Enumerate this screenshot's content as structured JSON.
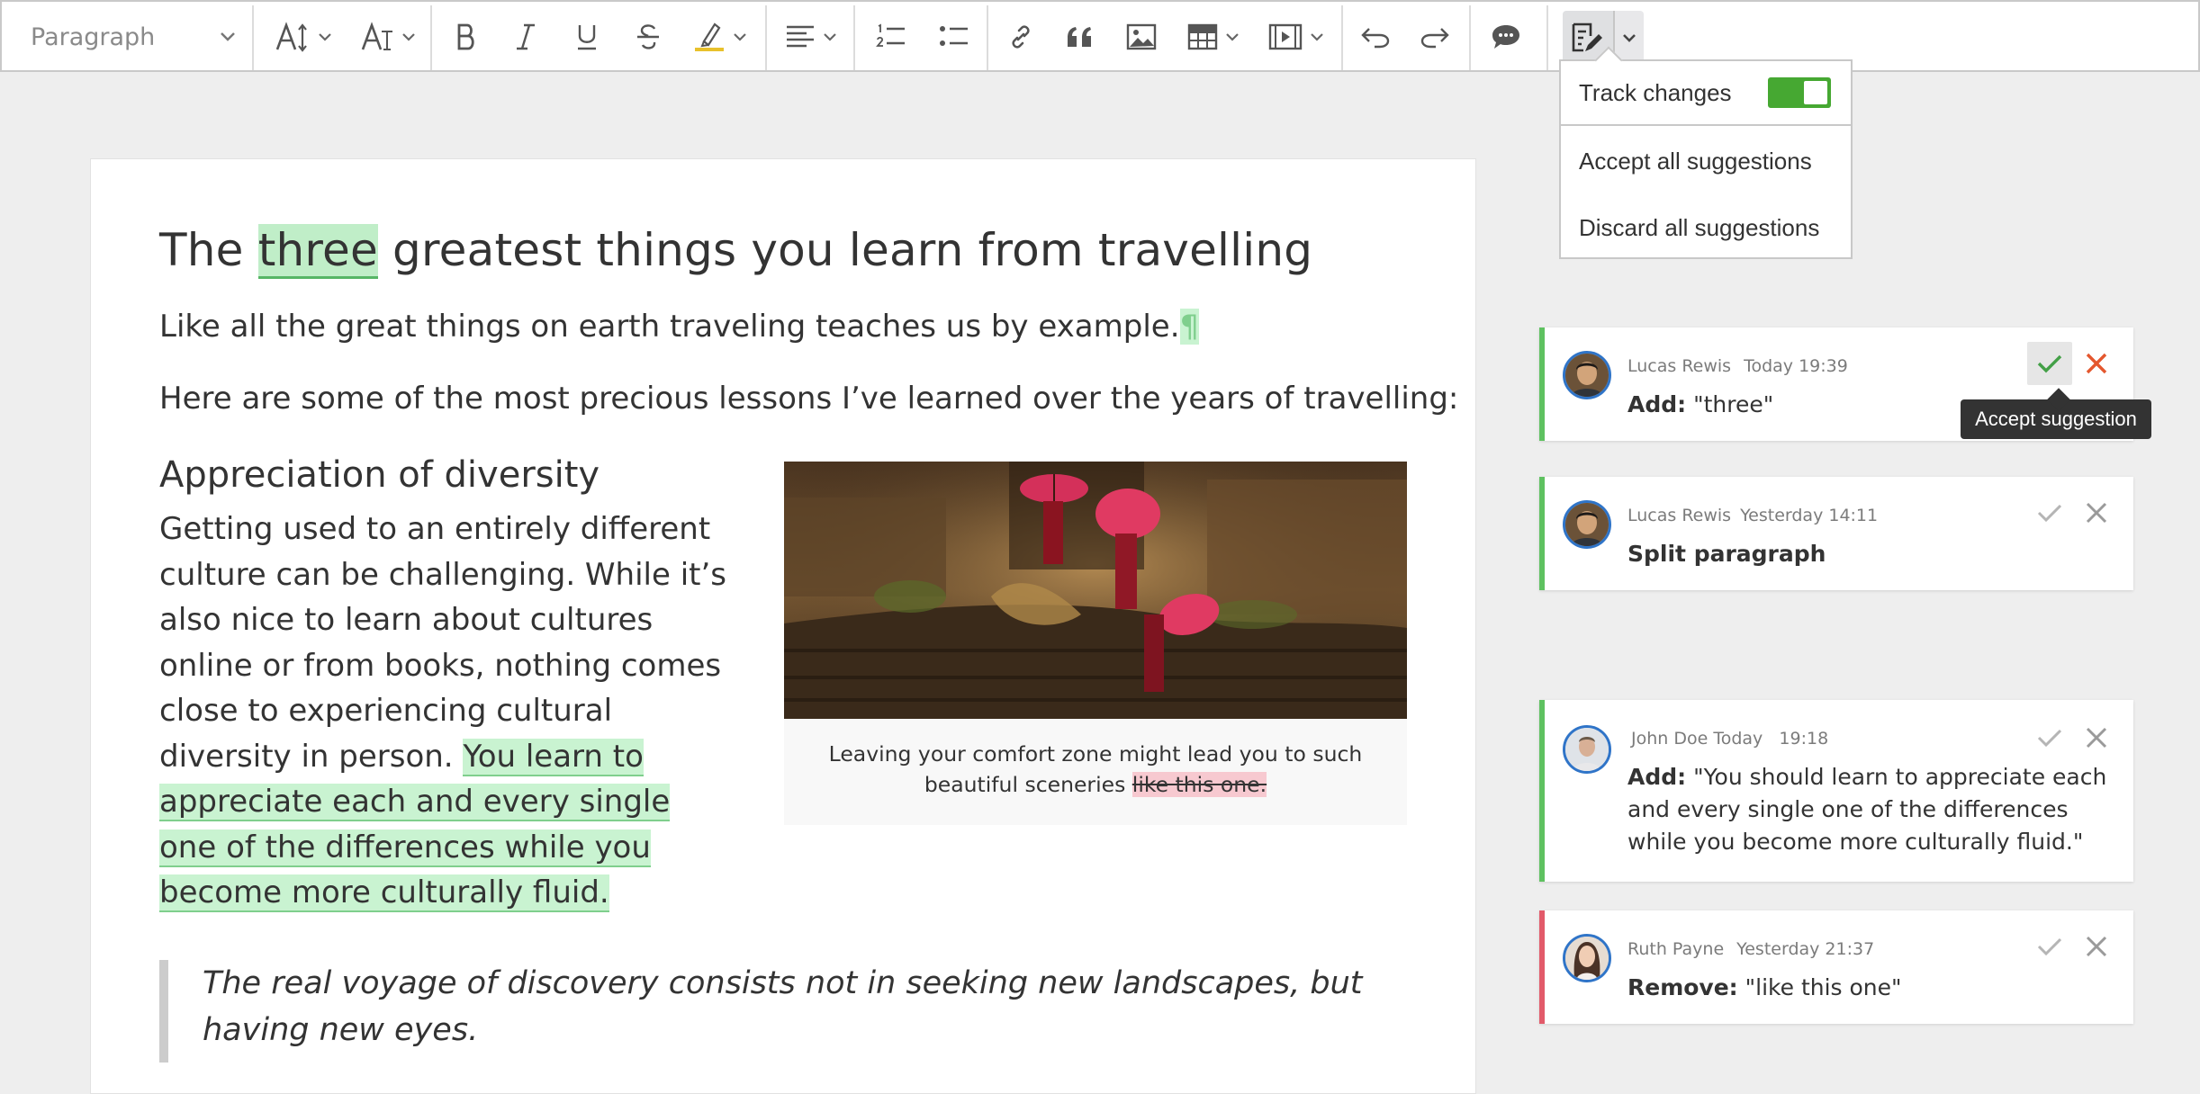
{
  "toolbar": {
    "paragraph_select": "Paragraph",
    "icons": [
      "font-size-icon",
      "font-family-icon",
      "bold-icon",
      "italic-icon",
      "underline-icon",
      "strikethrough-icon",
      "highlight-icon",
      "alignment-icon",
      "numbered-list-icon",
      "bulleted-list-icon",
      "link-icon",
      "blockquote-icon",
      "image-icon",
      "table-icon",
      "media-icon",
      "undo-icon",
      "redo-icon",
      "comment-icon",
      "track-changes-icon"
    ]
  },
  "track_menu": {
    "track_changes_label": "Track changes",
    "track_changes_on": true,
    "accept_all": "Accept all suggestions",
    "discard_all": "Discard all suggestions"
  },
  "document": {
    "title_before": "The ",
    "title_suggestion": "three",
    "title_after": " greatest things you learn from travelling",
    "para1_text": "Like all the great things on earth traveling teaches us by example.",
    "para1_mark": "¶",
    "para2": "Here are some of the most precious lessons I’ve learned over the years of travelling:",
    "heading2": "Appreciation of diversity",
    "para3_text": "Getting used to an entirely different culture can be challenging. While it’s also nice to learn about cultures online or from books, nothing comes close to experiencing cultural diversity in person. ",
    "para3_insert": "You learn to appreciate each and every single one of the differences while you become more culturally fluid.",
    "caption_text": "Leaving your comfort zone might lead you to such beautiful sceneries ",
    "caption_removed": "like this one.",
    "quote": "The real voyage of discovery consists not in seeking new landscapes, but having new eyes."
  },
  "suggestions": [
    {
      "author": "Lucas Rewis",
      "time": "Today 19:39",
      "label": "Add:",
      "text": "\"three\"",
      "status_color": "#5ec160"
    },
    {
      "author": "Lucas Rewis",
      "time": "Yesterday 14:11",
      "label": "",
      "text": "Split paragraph",
      "status_color": "#5ec160"
    },
    {
      "author": "John Doe",
      "time": "Today   19:18",
      "label": "Add:",
      "text": "\"You should learn to appreciate each and every single one of the differences while you become more culturally fluid.\"",
      "status_color": "#5ec160"
    },
    {
      "author": "Ruth Payne",
      "time": "Yesterday 21:37",
      "label": "Remove:",
      "text": "\"like this one\"",
      "status_color": "#e25a6a"
    }
  ],
  "tooltip": "Accept suggestion",
  "colors": {
    "insert_highlight": "#c9f3d1",
    "remove_highlight": "#f7c9d0",
    "toggle_on": "#46a832",
    "accept_active": "#43a047",
    "discard_active": "#e4572e"
  }
}
